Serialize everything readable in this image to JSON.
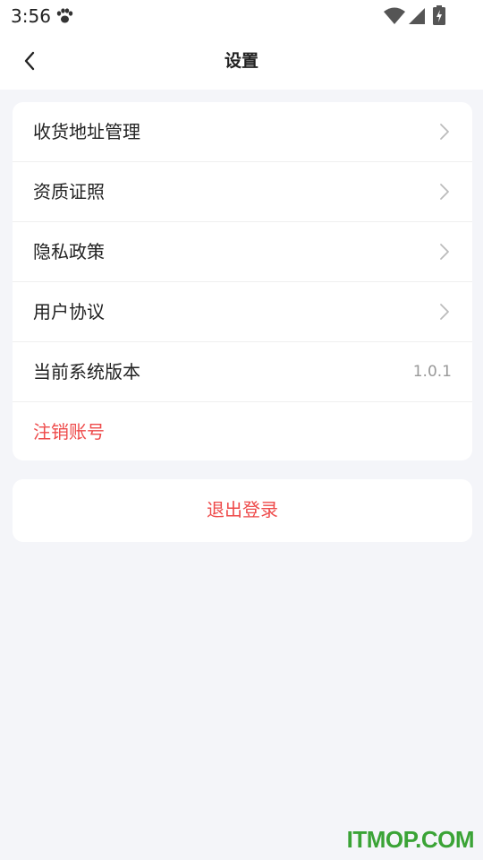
{
  "status_bar": {
    "time": "3:56",
    "icons": [
      "paw-icon",
      "wifi-icon",
      "signal-icon",
      "battery-icon"
    ]
  },
  "nav": {
    "title": "设置",
    "back_icon": "chevron-left-icon"
  },
  "settings": {
    "items": [
      {
        "label": "收货地址管理",
        "chevron": true
      },
      {
        "label": "资质证照",
        "chevron": true
      },
      {
        "label": "隐私政策",
        "chevron": true
      },
      {
        "label": "用户协议",
        "chevron": true
      },
      {
        "label": "当前系统版本",
        "value": "1.0.1"
      },
      {
        "label": "注销账号",
        "danger": true
      }
    ]
  },
  "logout": {
    "label": "退出登录"
  },
  "watermark": {
    "text": "ITMOP.COM"
  },
  "colors": {
    "background": "#f4f5f9",
    "card": "#ffffff",
    "danger": "#ee4a4a",
    "text": "#222222",
    "secondary": "#999999",
    "watermark": "#3aa336"
  }
}
